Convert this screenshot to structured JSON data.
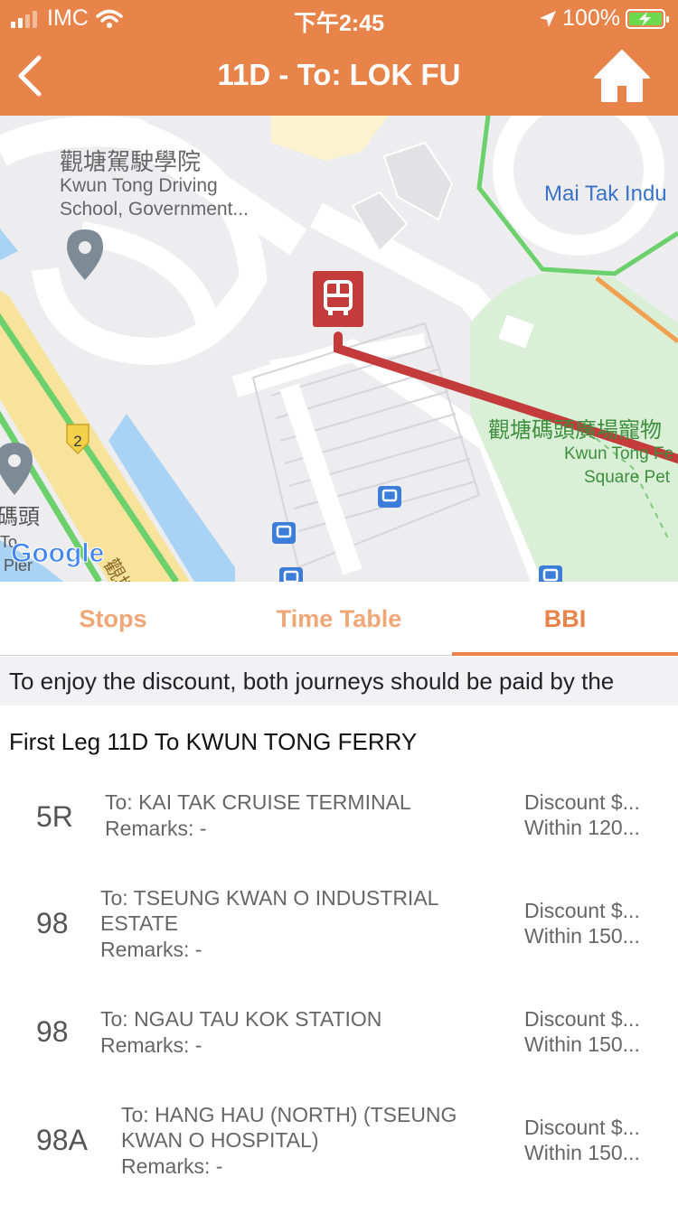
{
  "status_bar": {
    "carrier": "IMC",
    "time": "下午2:45",
    "battery": "100%"
  },
  "nav": {
    "title": "11D - To: LOK FU"
  },
  "map": {
    "labels": {
      "school_zh": "觀塘駕駛學院",
      "school_en_1": "Kwun Tong Driving",
      "school_en_2": "School, Government...",
      "mai_tak": "Mai Tak Indu",
      "plaza_zh": "觀塘碼頭廣場寵物",
      "plaza_en_1": "Kwun Tong Fe",
      "plaza_en_2": "Square Pet",
      "pier_zh": "碼頭",
      "pier_en_1": "To",
      "pier_en_2": "Pier",
      "road_no": "2",
      "road_zh": "觀塘",
      "google": "Google"
    },
    "colors": {
      "route_line": "#C33B3B",
      "green_path": "#6CD16C",
      "orange_path": "#F0A050",
      "road_yellow": "#F7E39A",
      "water": "#A9D3F5",
      "park": "#D9EFD6"
    }
  },
  "tabs": [
    {
      "label": "Stops"
    },
    {
      "label": "Time Table"
    },
    {
      "label": "BBI"
    }
  ],
  "notice": "To enjoy the discount, both journeys should be paid by the",
  "leg_title": "First Leg 11D To KWUN TONG FERRY",
  "routes": [
    {
      "route": "5R",
      "dest_1": "To: KAI TAK CRUISE TERMINAL",
      "dest_2": "",
      "remarks": "Remarks:  -",
      "discount": "Discount $...",
      "within": "Within 120..."
    },
    {
      "route": "98",
      "dest_1": "To: TSEUNG KWAN O INDUSTRIAL",
      "dest_2": "ESTATE",
      "remarks": "Remarks:  -",
      "discount": "Discount $...",
      "within": "Within 150..."
    },
    {
      "route": "98",
      "dest_1": "To: NGAU TAU KOK STATION",
      "dest_2": "",
      "remarks": "Remarks:  -",
      "discount": "Discount $...",
      "within": "Within 150..."
    },
    {
      "route": "98A",
      "dest_1": "To: HANG HAU (NORTH) (TSEUNG",
      "dest_2": "KWAN O HOSPITAL)",
      "remarks": "Remarks:  -",
      "discount": "Discount $...",
      "within": "Within 150..."
    }
  ]
}
